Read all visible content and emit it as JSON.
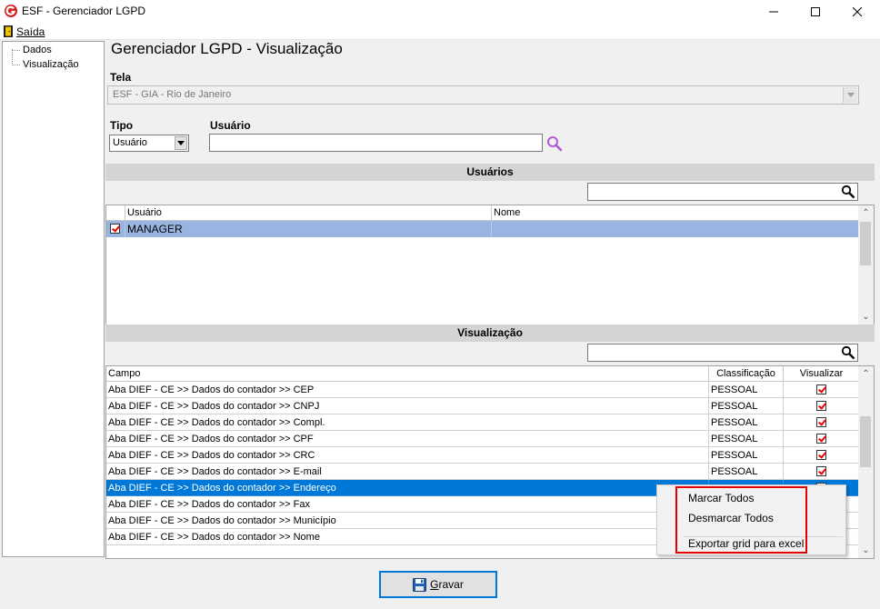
{
  "window": {
    "title": "ESF - Gerenciador LGPD"
  },
  "menu": {
    "saida": "Saída"
  },
  "tree": {
    "items": [
      "Dados",
      "Visualização"
    ]
  },
  "page": {
    "title": "Gerenciador LGPD - Visualização"
  },
  "form": {
    "tela_label": "Tela",
    "tela_value": "ESF - GIA - Rio de Janeiro",
    "tipo_label": "Tipo",
    "tipo_value": "Usuário",
    "usuario_label": "Usuário",
    "usuario_value": ""
  },
  "usuarios_section": {
    "title": "Usuários",
    "search_value": "",
    "columns": [
      "Usuário",
      "Nome"
    ],
    "rows": [
      {
        "checked": true,
        "usuario": "MANAGER",
        "nome": ""
      }
    ]
  },
  "visualizacao_section": {
    "title": "Visualização",
    "search_value": "",
    "columns": [
      "Campo",
      "Classificação",
      "Visualizar"
    ],
    "rows": [
      {
        "campo": "Aba DIEF - CE >> Dados do contador >> CEP",
        "classificacao": "PESSOAL",
        "visualizar": true
      },
      {
        "campo": "Aba DIEF - CE >> Dados do contador >> CNPJ",
        "classificacao": "PESSOAL",
        "visualizar": true
      },
      {
        "campo": "Aba DIEF - CE >> Dados do contador >> Compl.",
        "classificacao": "PESSOAL",
        "visualizar": true
      },
      {
        "campo": "Aba DIEF - CE >> Dados do contador >> CPF",
        "classificacao": "PESSOAL",
        "visualizar": true
      },
      {
        "campo": "Aba DIEF - CE >> Dados do contador >> CRC",
        "classificacao": "PESSOAL",
        "visualizar": true
      },
      {
        "campo": "Aba DIEF - CE >> Dados do contador >> E-mail",
        "classificacao": "PESSOAL",
        "visualizar": true
      },
      {
        "campo": "Aba DIEF - CE >> Dados do contador >> Endereço",
        "classificacao": "",
        "visualizar": true,
        "selected": true
      },
      {
        "campo": "Aba DIEF - CE >> Dados do contador >> Fax",
        "classificacao": "",
        "visualizar": false
      },
      {
        "campo": "Aba DIEF - CE >> Dados do contador >> Município",
        "classificacao": "",
        "visualizar": false
      },
      {
        "campo": "Aba DIEF - CE >> Dados do contador >> Nome",
        "classificacao": "",
        "visualizar": false
      }
    ]
  },
  "context_menu": {
    "items": [
      "Marcar Todos",
      "Desmarcar Todos",
      "Exportar grid para excel"
    ]
  },
  "buttons": {
    "gravar": "Gravar"
  },
  "colors": {
    "selection_blue": "#0078d7",
    "usuarios_row_highlight": "#99b4e0",
    "section_header": "#d4d4d4",
    "highlight_red": "#e30000"
  },
  "icons": {
    "app": "g-logo-icon",
    "saida": "exit-door-icon",
    "search": "magnifier-icon",
    "gravar": "floppy-disk-icon"
  }
}
